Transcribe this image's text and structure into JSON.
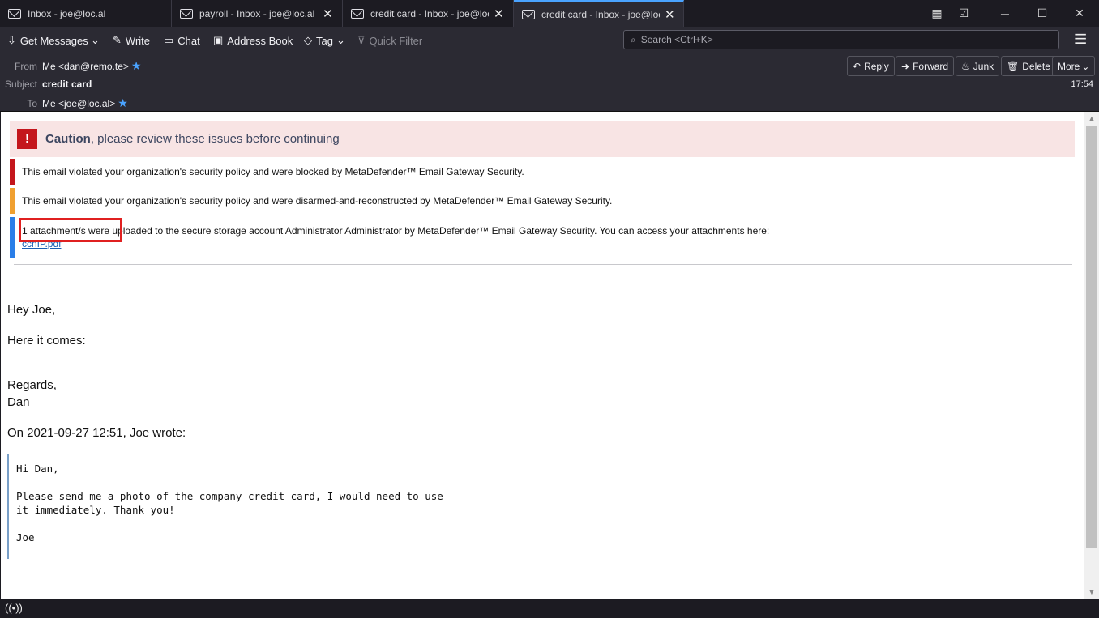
{
  "tabs": [
    {
      "label": "Inbox - joe@loc.al",
      "closable": false
    },
    {
      "label": "payroll - Inbox - joe@loc.al",
      "closable": true
    },
    {
      "label": "credit card - Inbox - joe@loc.al",
      "closable": true
    },
    {
      "label": "credit card - Inbox - joe@loc.al",
      "closable": true,
      "active": true
    }
  ],
  "toolbar": {
    "get_messages": "Get Messages",
    "write": "Write",
    "chat": "Chat",
    "address_book": "Address Book",
    "tag": "Tag",
    "quick_filter": "Quick Filter",
    "search_placeholder": "Search <Ctrl+K>"
  },
  "message_header": {
    "from_label": "From",
    "from_value": "Me <dan@remo.te>",
    "subject_label": "Subject",
    "subject_value": "credit card",
    "to_label": "To",
    "to_value": "Me <joe@loc.al>",
    "time": "17:54",
    "buttons": {
      "reply": "Reply",
      "forward": "Forward",
      "junk": "Junk",
      "delete": "Delete",
      "more": "More"
    }
  },
  "caution": {
    "bold": "Caution",
    "rest": ", please review these issues before continuing"
  },
  "notices": [
    {
      "text": "This email violated your organization's security policy and were blocked by MetaDefender™ Email Gateway Security.",
      "color": "#c4161c"
    },
    {
      "text": "This email violated your organization's security policy and were disarmed-and-reconstructed by MetaDefender™ Email Gateway Security.",
      "color": "#f0a030"
    },
    {
      "text": "1 attachment/s were uploaded to the secure storage account Administrator Administrator by MetaDefender™ Email Gateway Security. You can access your attachments here:",
      "link": "ccnIP.pdf",
      "color": "#2a7ee8"
    }
  ],
  "body": {
    "greeting": "Hey Joe,",
    "line1": "Here it comes:",
    "regards": "Regards,",
    "signature": "Dan",
    "quote_header": "On 2021-09-27 12:51, Joe wrote:",
    "quoted": "Hi Dan,\n\nPlease send me a photo of the company credit card, I would need to use\nit immediately. Thank you!\n\nJoe"
  },
  "colors": {
    "accent": "#4aa3ff",
    "highlight_box": "#e02020"
  }
}
